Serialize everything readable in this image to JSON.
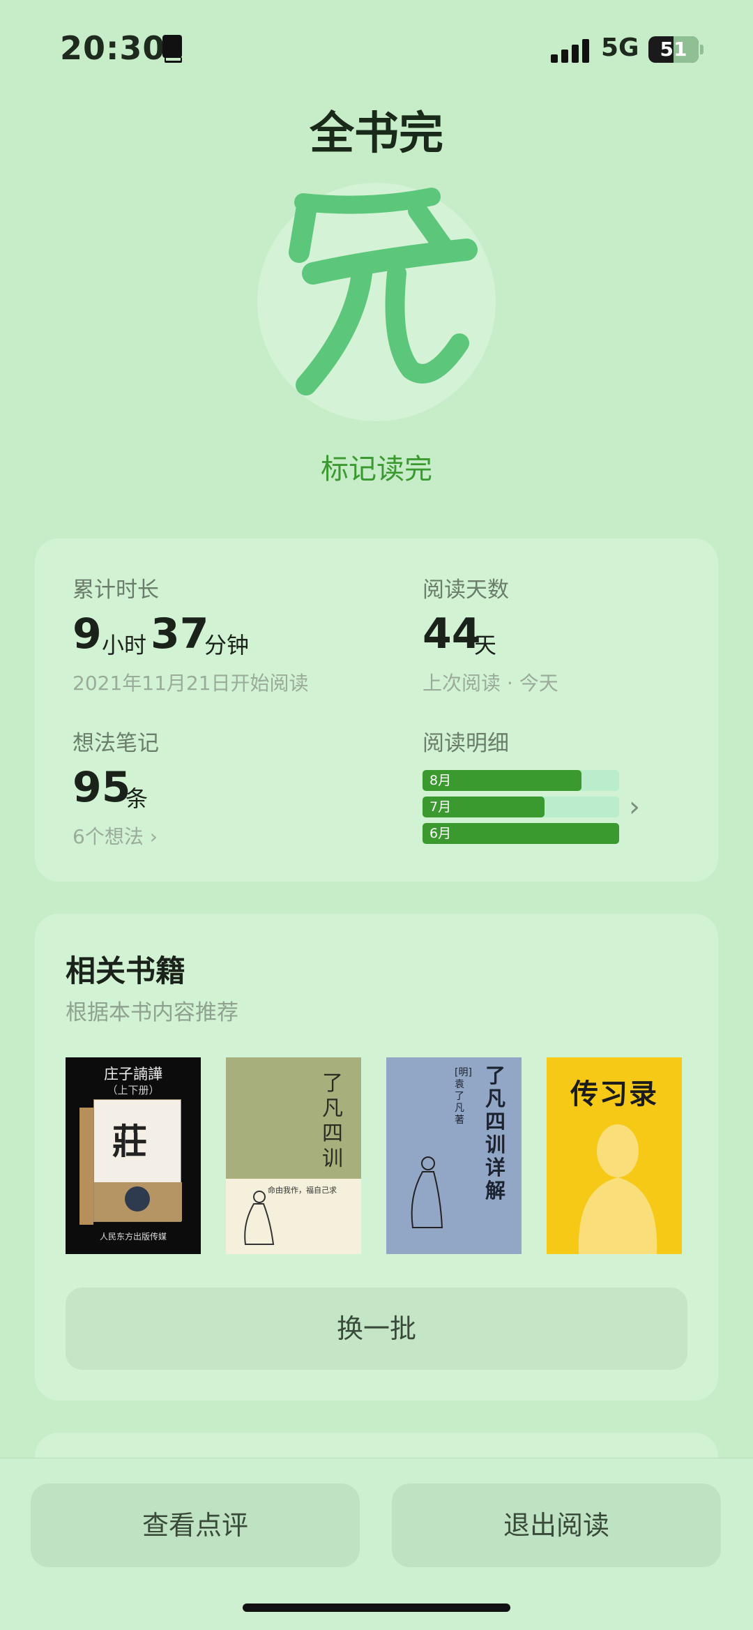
{
  "status_bar": {
    "time": "20:30",
    "network": "5G",
    "battery": "51"
  },
  "header": {
    "title": "全书完",
    "seal_char": "完",
    "mark_done_label": "标记读完"
  },
  "stats": {
    "total_time": {
      "label": "累计时长",
      "hours": "9",
      "hours_unit": "小时",
      "minutes": "37",
      "minutes_unit": "分钟",
      "start": "2021年11月21日开始阅读"
    },
    "reading_days": {
      "label": "阅读天数",
      "value": "44",
      "unit": "天",
      "last": "上次阅读 · 今天"
    },
    "notes": {
      "label": "想法笔记",
      "value": "95",
      "unit": "条",
      "thoughts": "6个想法"
    },
    "detail": {
      "label": "阅读明细",
      "months": [
        {
          "label": "8月",
          "fraction": 0.81
        },
        {
          "label": "7月",
          "fraction": 0.62
        },
        {
          "label": "6月",
          "fraction": 1.0
        }
      ]
    }
  },
  "related": {
    "title": "相关书籍",
    "subtitle": "根据本书内容推荐",
    "books": [
      {
        "title": "庄子諵譁",
        "subtitle": "（上下册）",
        "cover_char": "莊",
        "publisher": "人民东方出版传媒"
      },
      {
        "title": "了凡四训",
        "tagline": "命由我作，福自己求"
      },
      {
        "title": "了凡四训详解",
        "author": "[明] 袁了凡 著"
      },
      {
        "title": "传习录"
      }
    ],
    "swap_label": "换一批"
  },
  "bottom": {
    "review_label": "查看点评",
    "exit_label": "退出阅读"
  },
  "colors": {
    "background": "#c6ecc8",
    "card": "#d2f2d4",
    "accent": "#3b9a2f",
    "bar_track": "#b9edcc"
  }
}
